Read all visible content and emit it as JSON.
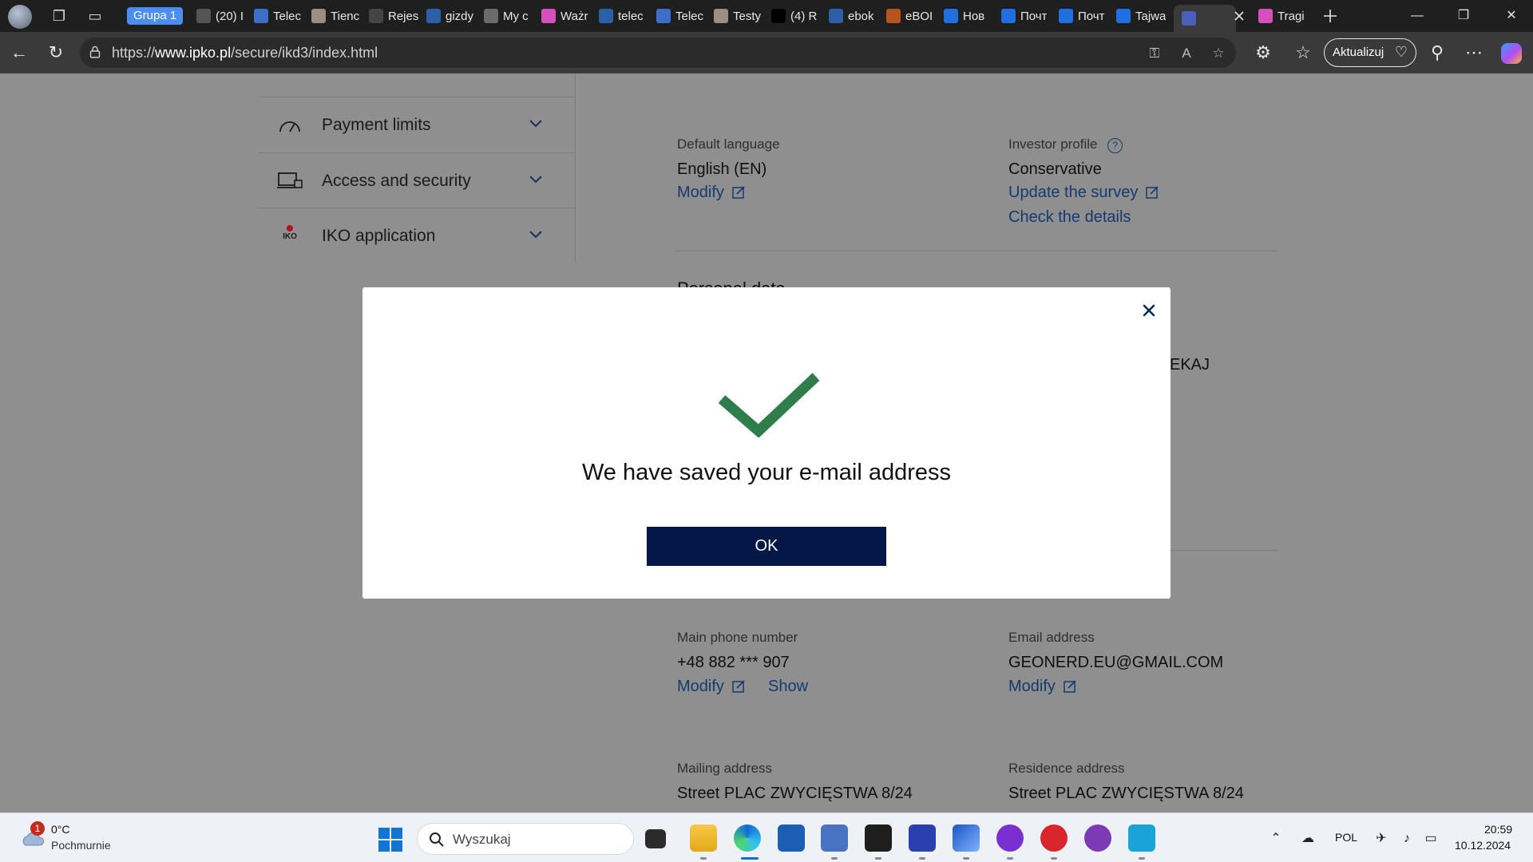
{
  "browser": {
    "group_label": "Grupa 1",
    "tabs": [
      {
        "title": "(20) I",
        "color": "#555555"
      },
      {
        "title": "Telec",
        "color": "#3b6fc9"
      },
      {
        "title": "Tienc",
        "color": "#9a8f80"
      },
      {
        "title": "Rejes",
        "color": "#444444"
      },
      {
        "title": "gizdy",
        "color": "#2b5fa8"
      },
      {
        "title": "My c",
        "color": "#6b6b6b"
      },
      {
        "title": "Ważr",
        "color": "#d64fbf"
      },
      {
        "title": "telec",
        "color": "#2b5fa8"
      },
      {
        "title": "Telec",
        "color": "#3b6fc9"
      },
      {
        "title": "Testy",
        "color": "#9a8f80"
      },
      {
        "title": "(4) R",
        "color": "#000000"
      },
      {
        "title": "ebok",
        "color": "#2b5fa8"
      },
      {
        "title": "eBOI",
        "color": "#b5541c"
      },
      {
        "title": "Нов",
        "color": "#1f6fe0"
      },
      {
        "title": "Почт",
        "color": "#1f6fe0"
      },
      {
        "title": "Почт",
        "color": "#1f6fe0"
      },
      {
        "title": "Tajwa",
        "color": "#1f6fe0"
      },
      {
        "title": "",
        "color": "#4a5fb8",
        "active": true
      },
      {
        "title": "Tragi",
        "color": "#d64fbf"
      }
    ],
    "address": {
      "prefix": "https://",
      "host": "www.ipko.pl",
      "path": "/secure/ikd3/index.html"
    },
    "update_label": "Aktualizuj"
  },
  "sidebar": {
    "items": [
      {
        "label": "Payment limits"
      },
      {
        "label": "Access and security"
      },
      {
        "label": "IKO application",
        "icon_text": "IKO"
      }
    ]
  },
  "settings": {
    "default_language": {
      "label": "Default language",
      "value": "English (EN)",
      "modify": "Modify"
    },
    "investor_profile": {
      "label": "Investor profile",
      "value": "Conservative",
      "update_link": "Update the survey",
      "details_link": "Check the details"
    },
    "personal_data_heading": "Personal data",
    "partial_name": "EKAJ",
    "main_phone": {
      "label": "Main phone number",
      "value": "+48 882 *** 907",
      "modify": "Modify",
      "show": "Show"
    },
    "email": {
      "label": "Email address",
      "value": "GEONERD.EU@GMAIL.COM",
      "modify": "Modify"
    },
    "mailing_address": {
      "label": "Mailing address",
      "line1": "Street PLAC ZWYCIĘSTWA 8/24"
    },
    "residence_address": {
      "label": "Residence address",
      "line1": "Street PLAC ZWYCIĘSTWA 8/24"
    }
  },
  "modal": {
    "message": "We have saved your e-mail address",
    "ok_label": "OK",
    "check_color": "#2e7d4a"
  },
  "taskbar": {
    "weather": {
      "badge": "1",
      "temp": "0°C",
      "desc": "Pochmurnie"
    },
    "search_placeholder": "Wyszukaj",
    "language": "POL",
    "time": "20:59",
    "date": "10.12.2024"
  },
  "colors": {
    "accent": "#031846",
    "link": "#143a6e"
  }
}
